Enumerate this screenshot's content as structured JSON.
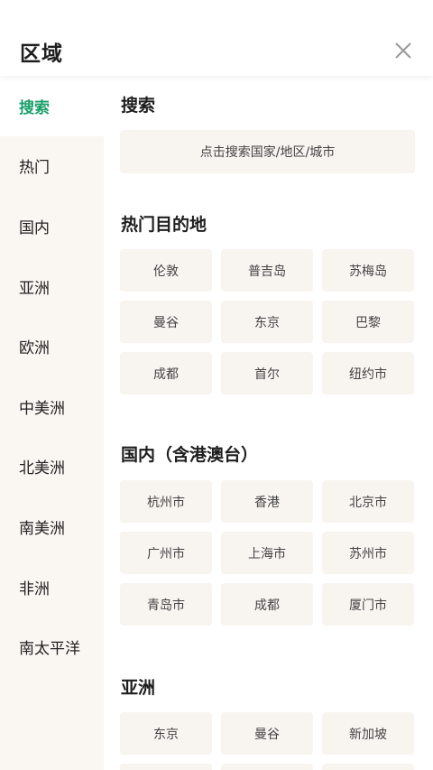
{
  "header": {
    "title": "区域"
  },
  "sidebar": {
    "items": [
      {
        "label": "搜索"
      },
      {
        "label": "热门"
      },
      {
        "label": "国内"
      },
      {
        "label": "亚洲"
      },
      {
        "label": "欧洲"
      },
      {
        "label": "中美洲"
      },
      {
        "label": "北美洲"
      },
      {
        "label": "南美洲"
      },
      {
        "label": "非洲"
      },
      {
        "label": "南太平洋"
      }
    ]
  },
  "search": {
    "title": "搜索",
    "placeholder": "点击搜索国家/地区/城市"
  },
  "hot": {
    "title": "热门目的地",
    "items": [
      "伦敦",
      "普吉岛",
      "苏梅岛",
      "曼谷",
      "东京",
      "巴黎",
      "成都",
      "首尔",
      "纽约市"
    ]
  },
  "domestic": {
    "title": "国内（含港澳台）",
    "items": [
      "杭州市",
      "香港",
      "北京市",
      "广州市",
      "上海市",
      "苏州市",
      "青岛市",
      "成都",
      "厦门市"
    ]
  },
  "asia": {
    "title": "亚洲",
    "items": [
      "东京",
      "曼谷",
      "新加坡"
    ]
  },
  "colors": {
    "accent": "#1aa06a",
    "sidebar_bg": "#faf6f2",
    "chip_bg": "#f8f4f0",
    "status_dot": "#e0101e"
  }
}
